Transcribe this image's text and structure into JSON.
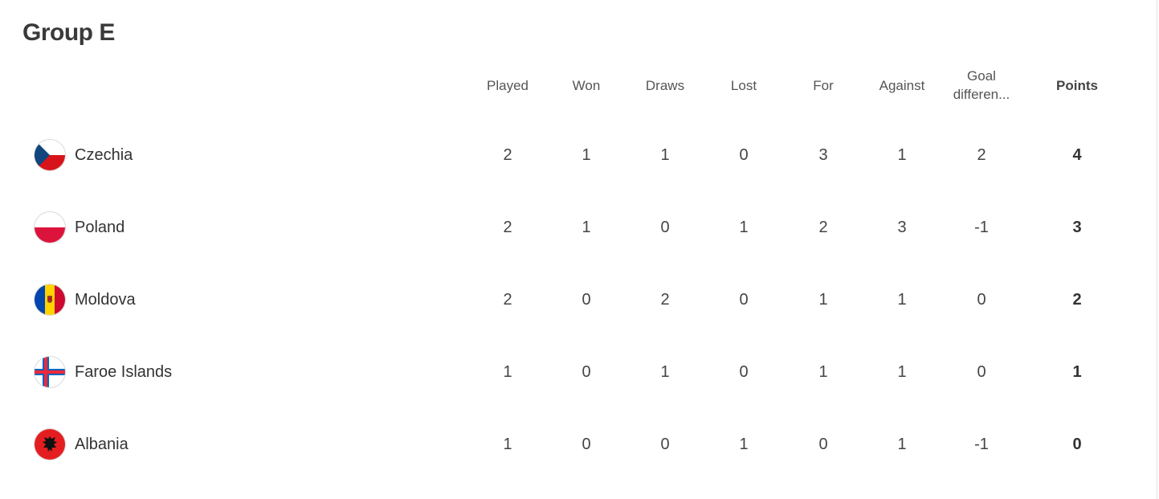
{
  "group": {
    "title": "Group E"
  },
  "headers": {
    "played": "Played",
    "won": "Won",
    "draws": "Draws",
    "lost": "Lost",
    "for": "For",
    "against": "Against",
    "goal_difference": "Goal differen...",
    "points": "Points"
  },
  "rows": [
    {
      "team": "Czechia",
      "flag_icon": "czechia-flag-icon",
      "played": "2",
      "won": "1",
      "draws": "1",
      "lost": "0",
      "for": "3",
      "against": "1",
      "goal_difference": "2",
      "points": "4"
    },
    {
      "team": "Poland",
      "flag_icon": "poland-flag-icon",
      "played": "2",
      "won": "1",
      "draws": "0",
      "lost": "1",
      "for": "2",
      "against": "3",
      "goal_difference": "-1",
      "points": "3"
    },
    {
      "team": "Moldova",
      "flag_icon": "moldova-flag-icon",
      "played": "2",
      "won": "0",
      "draws": "2",
      "lost": "0",
      "for": "1",
      "against": "1",
      "goal_difference": "0",
      "points": "2"
    },
    {
      "team": "Faroe Islands",
      "flag_icon": "faroe-islands-flag-icon",
      "played": "1",
      "won": "0",
      "draws": "1",
      "lost": "0",
      "for": "1",
      "against": "1",
      "goal_difference": "0",
      "points": "1"
    },
    {
      "team": "Albania",
      "flag_icon": "albania-flag-icon",
      "played": "1",
      "won": "0",
      "draws": "0",
      "lost": "1",
      "for": "0",
      "against": "1",
      "goal_difference": "-1",
      "points": "0"
    }
  ],
  "colors": {
    "czechia_blue": "#11457e",
    "czechia_red": "#d7141a",
    "poland_red": "#dc143c",
    "moldova_blue": "#0046ae",
    "moldova_yellow": "#ffd200",
    "moldova_red": "#cc092f",
    "faroe_blue": "#0065bd",
    "faroe_red": "#ed2939",
    "albania_red": "#e41e20"
  }
}
